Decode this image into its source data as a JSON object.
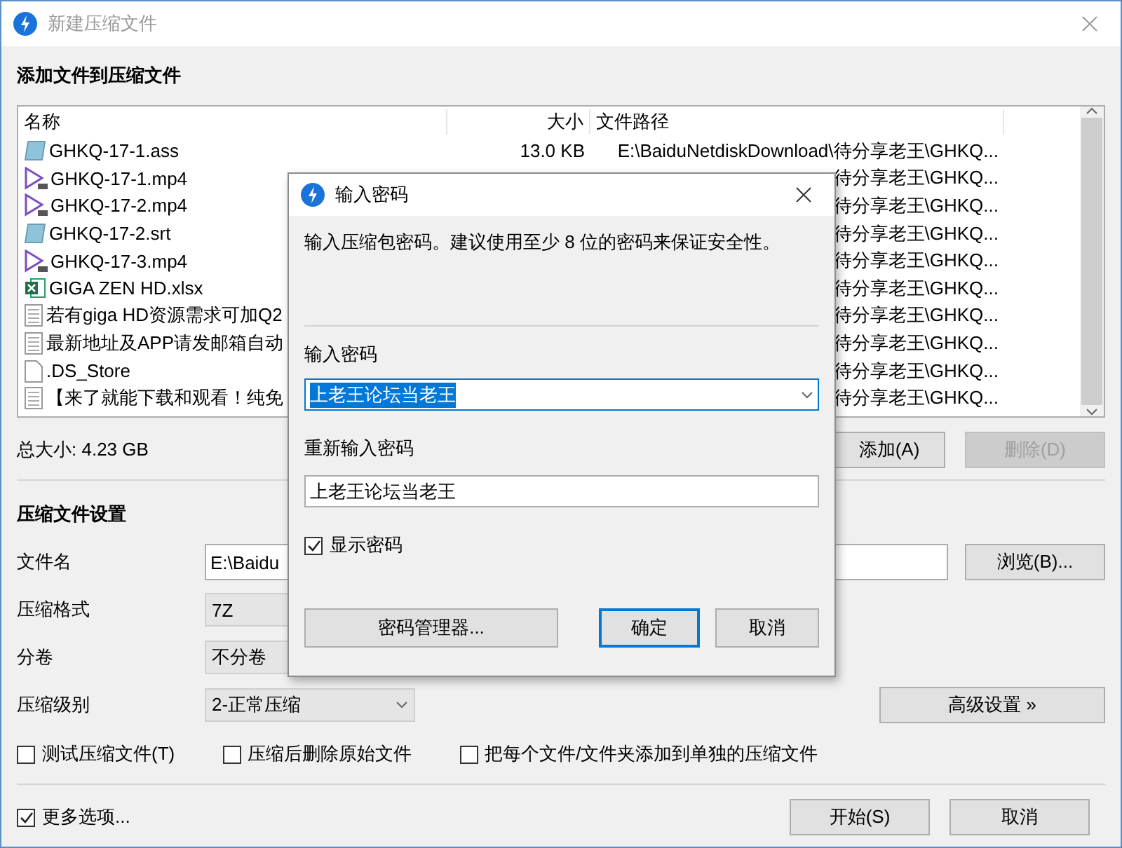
{
  "window": {
    "title": "新建压缩文件"
  },
  "files_section": {
    "heading": "添加文件到压缩文件",
    "columns": [
      "名称",
      "大小",
      "文件路径"
    ],
    "rows": [
      {
        "kind": "subtitle",
        "name": "GHKQ-17-1.ass",
        "size": "13.0 KB",
        "path": "E:\\BaiduNetdiskDownload\\待分享老王\\GHKQ..."
      },
      {
        "kind": "video",
        "name": "GHKQ-17-1.mp4",
        "path": "待分享老王\\GHKQ..."
      },
      {
        "kind": "video",
        "name": "GHKQ-17-2.mp4",
        "path": "待分享老王\\GHKQ..."
      },
      {
        "kind": "subtitle",
        "name": "GHKQ-17-2.srt",
        "path": "待分享老王\\GHKQ..."
      },
      {
        "kind": "video",
        "name": "GHKQ-17-3.mp4",
        "path": "待分享老王\\GHKQ..."
      },
      {
        "kind": "sheet",
        "name": "GIGA ZEN HD.xlsx",
        "path": "待分享老王\\GHKQ..."
      },
      {
        "kind": "text",
        "name": "若有giga HD资源需求可加Q2",
        "path": "待分享老王\\GHKQ..."
      },
      {
        "kind": "text",
        "name": "最新地址及APP请发邮箱自动",
        "path": "待分享老王\\GHKQ..."
      },
      {
        "kind": "blank",
        "name": ".DS_Store",
        "path": "待分享老王\\GHKQ..."
      },
      {
        "kind": "text",
        "name": "【来了就能下载和观看！纯免",
        "path": "待分享老王\\GHKQ..."
      }
    ],
    "total": "总大小: 4.23 GB",
    "buttons": [
      {
        "label": "添加(A)",
        "disabled": false
      },
      {
        "label": "删除(D)",
        "disabled": true
      }
    ]
  },
  "settings": {
    "heading": "压缩文件设置",
    "rows": [
      {
        "label": "文件名",
        "kind": "text-field",
        "value": "E:\\Baidu",
        "button": "浏览(B)..."
      },
      {
        "label": "压缩格式",
        "kind": "combo",
        "value": "7Z"
      },
      {
        "label": "分卷",
        "kind": "combo",
        "value": "不分卷"
      },
      {
        "label": "压缩级别",
        "kind": "dropdown",
        "value": "2-正常压缩",
        "button": "高级设置 »"
      }
    ],
    "options": [
      {
        "label": "测试压缩文件(T)",
        "checked": false
      },
      {
        "label": "压缩后删除原始文件",
        "checked": false
      },
      {
        "label": "把每个文件/文件夹添加到单独的压缩文件",
        "checked": false
      }
    ]
  },
  "footer": {
    "more_options": {
      "label": "更多选项...",
      "checked": true
    },
    "buttons": [
      "开始(S)",
      "取消"
    ]
  },
  "password_dialog": {
    "title": "输入密码",
    "hint": "输入压缩包密码。建议使用至少 8 位的密码来保证安全性。",
    "password_label": "输入密码",
    "password": {
      "value": "上老王论坛当老王",
      "selected": true
    },
    "confirm_label": "重新输入密码",
    "confirm": {
      "value": "上老王论坛当老王",
      "selected": false
    },
    "show_password": {
      "label": "显示密码",
      "checked": true
    },
    "buttons": [
      {
        "label": "密码管理器...",
        "default": false
      },
      {
        "label": "确定",
        "default": true
      },
      {
        "label": "取消",
        "default": false
      }
    ]
  }
}
